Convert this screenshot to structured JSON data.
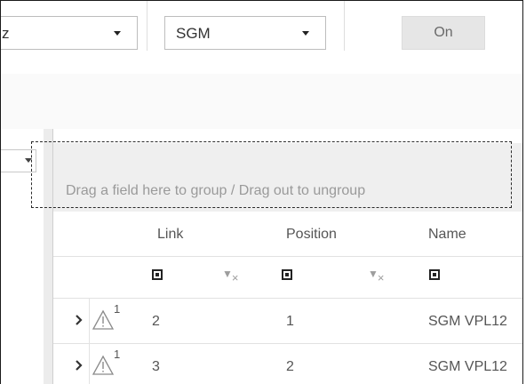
{
  "toolbar": {
    "select1": {
      "value": "z"
    },
    "select2": {
      "value": "SGM"
    },
    "on_button": "On"
  },
  "grid": {
    "group_panel_text": "Drag a field here to group / Drag out to ungroup",
    "columns": [
      "Link",
      "Position",
      "Name"
    ],
    "rows": [
      {
        "badge": "1",
        "link": "2",
        "position": "1",
        "name": "SGM VPL12"
      },
      {
        "badge": "1",
        "link": "3",
        "position": "2",
        "name": "SGM VPL12"
      }
    ]
  },
  "icons": {
    "dropdown": "chevron-down-icon",
    "checkbox": "checkbox-indeterminate-icon",
    "filter_clear": "filter-clear-icon",
    "expand": "chevron-right-icon",
    "warning": "warning-triangle-icon"
  },
  "colors": {
    "group_panel_bg": "#efefef",
    "button_bg": "#e6e6e6",
    "text": "#555555"
  }
}
